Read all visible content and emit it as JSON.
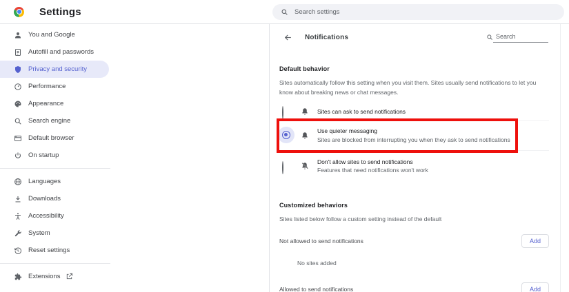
{
  "colors": {
    "accent": "#5561cf",
    "accent_soft": "#e7e9f9",
    "annotation_red": "#ee100c",
    "chrome_logo": [
      "#ea4335",
      "#fbbc05",
      "#34a853",
      "#4285f4"
    ]
  },
  "header": {
    "title": "Settings",
    "search_placeholder": "Search settings"
  },
  "sidebar": {
    "items": [
      {
        "label": "You and Google",
        "icon": "person-icon"
      },
      {
        "label": "Autofill and passwords",
        "icon": "autofill-icon"
      },
      {
        "label": "Privacy and security",
        "icon": "shield-icon",
        "selected": true
      },
      {
        "label": "Performance",
        "icon": "speedometer-icon"
      },
      {
        "label": "Appearance",
        "icon": "palette-icon"
      },
      {
        "label": "Search engine",
        "icon": "search-icon"
      },
      {
        "label": "Default browser",
        "icon": "browser-icon"
      },
      {
        "label": "On startup",
        "icon": "power-icon"
      },
      {
        "label": "Languages",
        "icon": "globe-icon"
      },
      {
        "label": "Downloads",
        "icon": "download-icon"
      },
      {
        "label": "Accessibility",
        "icon": "accessibility-icon"
      },
      {
        "label": "System",
        "icon": "wrench-icon"
      },
      {
        "label": "Reset settings",
        "icon": "reset-icon"
      },
      {
        "label": "Extensions",
        "icon": "puzzle-icon",
        "external": true
      }
    ]
  },
  "content": {
    "title": "Notifications",
    "search_placeholder": "Search",
    "default_behavior": {
      "heading": "Default behavior",
      "description": "Sites automatically follow this setting when you visit them. Sites usually send notifications to let you know about breaking news or chat messages.",
      "options": [
        {
          "label": "Sites can ask to send notifications",
          "selected": false,
          "icon": "bell-icon"
        },
        {
          "label": "Use quieter messaging",
          "sublabel": "Sites are blocked from interrupting you when they ask to send notifications",
          "selected": true,
          "highlighted": true,
          "icon": "bell-icon"
        },
        {
          "label": "Don't allow sites to send notifications",
          "sublabel": "Features that need notifications won't work",
          "selected": false,
          "icon": "bell-off-icon"
        }
      ]
    },
    "customized_behaviors": {
      "heading": "Customized behaviors",
      "description": "Sites listed below follow a custom setting instead of the default",
      "sections": [
        {
          "label": "Not allowed to send notifications",
          "button": "Add",
          "empty_text": "No sites added"
        },
        {
          "label": "Allowed to send notifications",
          "button": "Add"
        }
      ]
    }
  }
}
